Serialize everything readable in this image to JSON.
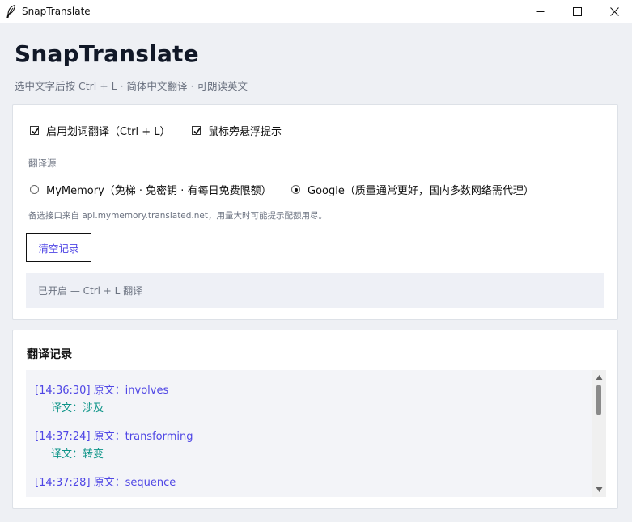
{
  "window": {
    "title": "SnapTranslate",
    "icon": "feather-icon"
  },
  "header": {
    "title": "SnapTranslate",
    "subtitle": "选中文字后按 Ctrl + L · 简体中文翻译 · 可朗读英文"
  },
  "settings": {
    "enable_label": "启用划词翻译（Ctrl + L）",
    "enable_checked": true,
    "hover_label": "鼠标旁悬浮提示",
    "hover_checked": true,
    "source_label": "翻译源",
    "sources": [
      {
        "label": "MyMemory（免梯 · 免密钥 · 有每日免费限额）",
        "selected": false
      },
      {
        "label": "Google（质量通常更好，国内多数网络需代理）",
        "selected": true
      }
    ],
    "hint": "备选接口来自 api.mymemory.translated.net，用量大时可能提示配额用尽。",
    "clear_button": "清空记录",
    "status": "已开启 — Ctrl + L 翻译"
  },
  "history": {
    "title": "翻译记录",
    "entries": [
      {
        "source": "[14:36:30] 原文：involves",
        "translation": "译文：涉及"
      },
      {
        "source": "[14:37:24] 原文：transforming",
        "translation": "译文：转变"
      },
      {
        "source": "[14:37:28] 原文：sequence",
        "translation": ""
      }
    ]
  },
  "colors": {
    "accent": "#4f46e5",
    "translation": "#0d9488",
    "muted": "#6b7280"
  }
}
